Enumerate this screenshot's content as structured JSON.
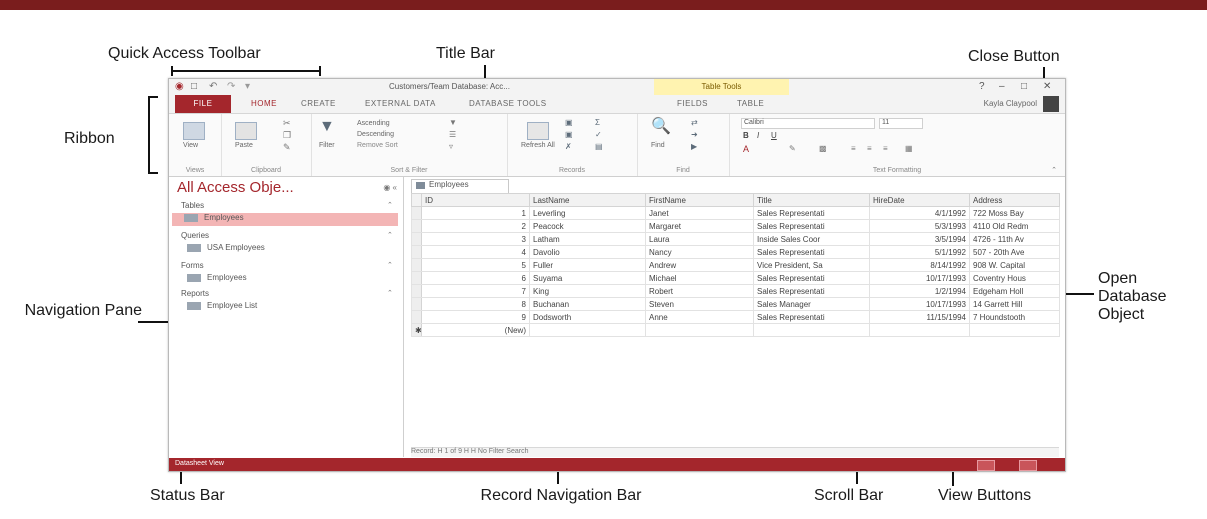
{
  "callouts": {
    "quick_access_toolbar": "Quick Access Toolbar",
    "title_bar": "Title Bar",
    "close_button": "Close Button",
    "ribbon": "Ribbon",
    "navigation_pane": "Navigation Pane",
    "open_database_object": "Open Database Object",
    "status_bar": "Status Bar",
    "record_navigation_bar": "Record Navigation Bar",
    "scroll_bar": "Scroll Bar",
    "view_buttons": "View Buttons"
  },
  "app": {
    "title": "Customers/Team Database: Acc...",
    "tool_tab": "Table Tools",
    "tabs": [
      "FILE",
      "HOME",
      "CREATE",
      "EXTERNAL DATA",
      "DATABASE TOOLS",
      "FIELDS",
      "TABLE"
    ],
    "active_tab": "HOME",
    "user": "Kayla Claypool",
    "ribbon_groups": [
      "Views",
      "Clipboard",
      "Sort & Filter",
      "Records",
      "Find",
      "Text Formatting"
    ],
    "ribbon_buttons": {
      "view": "View",
      "paste": "Paste",
      "filter": "Filter",
      "ascending": "Ascending",
      "descending": "Descending",
      "remove_sort": "Remove Sort",
      "refresh": "Refresh All",
      "find": "Find",
      "font": "Calibri",
      "font_size": "11"
    },
    "nav": {
      "header": "All Access Obje...",
      "groups": [
        {
          "label": "Tables",
          "items": [
            "Employees"
          ]
        },
        {
          "label": "Queries",
          "items": [
            "USA Employees"
          ]
        },
        {
          "label": "Forms",
          "items": [
            "Employees"
          ]
        },
        {
          "label": "Reports",
          "items": [
            "Employee List"
          ]
        }
      ]
    },
    "doc_tab": "Employees",
    "columns": [
      "ID",
      "LastName",
      "FirstName",
      "Title",
      "HireDate",
      "Address"
    ],
    "rows": [
      [
        "1",
        "Leverling",
        "Janet",
        "Sales Representati",
        "4/1/1992",
        "722 Moss Bay"
      ],
      [
        "2",
        "Peacock",
        "Margaret",
        "Sales Representati",
        "5/3/1993",
        "4110 Old Redm"
      ],
      [
        "3",
        "Latham",
        "Laura",
        "Inside Sales Coor",
        "3/5/1994",
        "4726 - 11th Av"
      ],
      [
        "4",
        "Davolio",
        "Nancy",
        "Sales Representati",
        "5/1/1992",
        "507 - 20th Ave"
      ],
      [
        "5",
        "Fuller",
        "Andrew",
        "Vice President, Sa",
        "8/14/1992",
        "908 W. Capital"
      ],
      [
        "6",
        "Suyama",
        "Michael",
        "Sales Representati",
        "10/17/1993",
        "Coventry Hous"
      ],
      [
        "7",
        "King",
        "Robert",
        "Sales Representati",
        "1/2/1994",
        "Edgeham Holl"
      ],
      [
        "8",
        "Buchanan",
        "Steven",
        "Sales Manager",
        "10/17/1993",
        "14 Garrett Hill"
      ],
      [
        "9",
        "Dodsworth",
        "Anne",
        "Sales Representati",
        "11/15/1994",
        "7 Houndstooth"
      ]
    ],
    "new_row_label": "(New)",
    "record_nav": "Record: H  1 of 9  H  H  No Filter  Search",
    "status": "Datasheet View"
  },
  "colors": {
    "accent": "#a4262c",
    "strip": "#7a1d1d",
    "selected_nav": "#f3b5b5"
  }
}
